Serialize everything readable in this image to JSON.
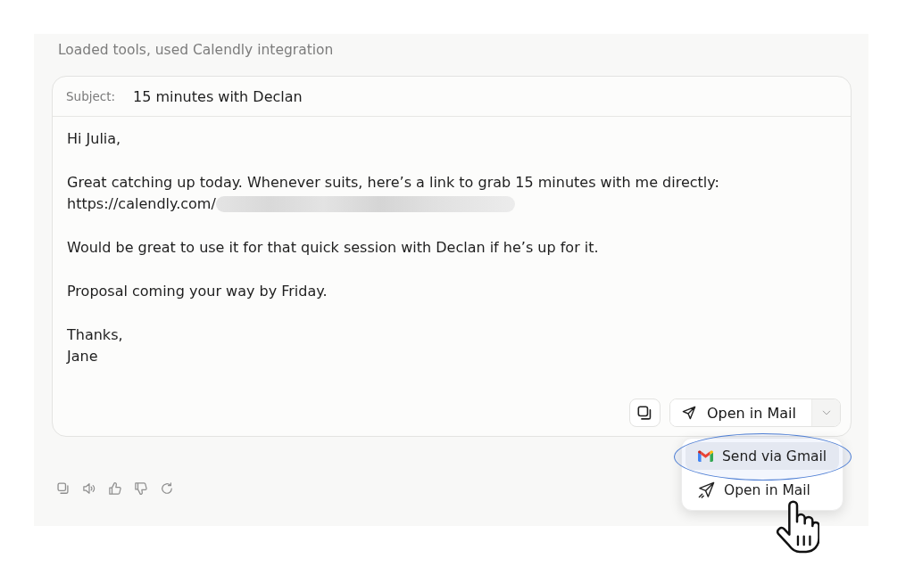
{
  "status_line": "Loaded tools, used Calendly integration",
  "email_draft": {
    "subject_label": "Subject:",
    "subject": "15 minutes with Declan",
    "paragraphs": [
      {
        "lines": [
          {
            "text": "Hi Julia,",
            "redacted_tail": false
          }
        ]
      },
      {
        "lines": [
          {
            "text": "Great catching up today. Whenever suits, here’s a link to grab 15 minutes with me directly:",
            "redacted_tail": false
          },
          {
            "text": "https://calendly.com/",
            "redacted_tail": true
          }
        ]
      },
      {
        "lines": [
          {
            "text": "Would be great to use it for that quick session with Declan if he’s up for it.",
            "redacted_tail": false
          }
        ]
      },
      {
        "lines": [
          {
            "text": "Proposal coming your way by Friday.",
            "redacted_tail": false
          }
        ]
      },
      {
        "lines": [
          {
            "text": "Thanks,",
            "redacted_tail": false
          },
          {
            "text": "Jane",
            "redacted_tail": false
          }
        ]
      }
    ],
    "send_button": {
      "label": "Open in Mail",
      "expanded": true,
      "menu": [
        {
          "kind": "gmail",
          "label": "Send via Gmail",
          "selected": true,
          "circled": true
        },
        {
          "kind": "mail",
          "label": "Open in Mail",
          "selected": false,
          "circled": false
        }
      ]
    }
  }
}
